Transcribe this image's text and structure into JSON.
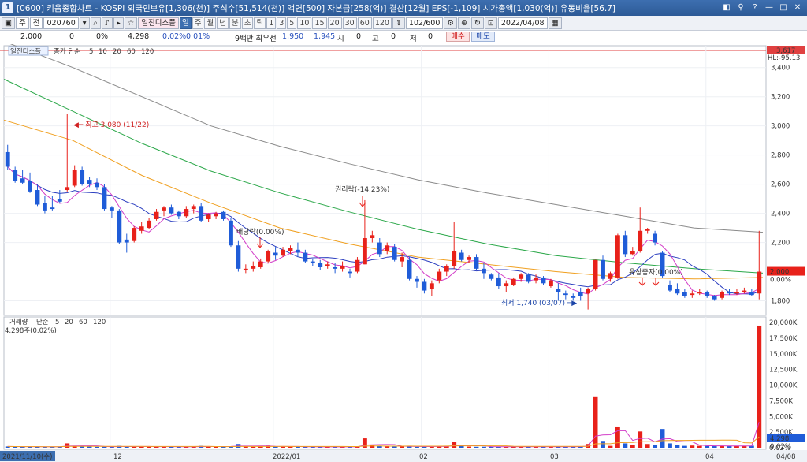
{
  "window": {
    "icon_label": "1",
    "title": "[0600] 키움종합차트 - KOSPI 외국인보유[1,306(천)] 주식수[51,514(천)] 액면[500] 자본금[258(억)] 결산[12월] EPS[-1,109] 시가총액[1,030(억)] 유동비율[56.7]"
  },
  "toolbar": {
    "mode_label": "주",
    "market_label": "전",
    "code_value": "020760",
    "stock_name": "일진디스플",
    "period_buttons": [
      "일",
      "주",
      "월",
      "년",
      "분",
      "초",
      "틱"
    ],
    "selected_period": "일",
    "minute_buttons": [
      "1",
      "3",
      "5",
      "10",
      "15",
      "20",
      "30",
      "60",
      "120"
    ],
    "count_value": "102",
    "count_total": "/600",
    "date_value": "2022/04/08"
  },
  "quote": {
    "price": "2,000",
    "change": "0",
    "change_pct": "0%",
    "volume": "4,298",
    "vol_ratio": "0.02%",
    "turnover": "0.01%",
    "bid_ask_label": "9백만 최우선",
    "ask_price": "1,950",
    "bid_price": "1,945",
    "open_label": "시",
    "open_value": "0",
    "high_label": "고",
    "high_value": "0",
    "low_label": "저",
    "low_value": "0",
    "buy_label": "매수",
    "sell_label": "매도"
  },
  "chart_data": {
    "type": "candlestick",
    "price_legend": {
      "name": "일진디스플",
      "ma_title": "종가 단순",
      "ma_periods": [
        "5",
        "10",
        "20",
        "60",
        "120"
      ],
      "ma_colors": [
        "#d23cc8",
        "#2c3fc0",
        "#f0a020",
        "#2ca84a",
        "#8a8a8a"
      ]
    },
    "volume_legend": {
      "name": "거래량",
      "ma_title": "단순",
      "ma_periods": [
        "5",
        "20",
        "60",
        "120"
      ],
      "value_line": "4,298주(0.02%)"
    },
    "price_axis_ticks": [
      3400,
      3200,
      3000,
      2800,
      2600,
      2400,
      2200,
      1800
    ],
    "price_axis_range": [
      1700,
      3550
    ],
    "volume_axis_ticks": [
      "20,000K",
      "17,500K",
      "15,000K",
      "12,500K",
      "10,000K",
      "7,500K",
      "5,000K",
      "2,500K",
      "0.02%"
    ],
    "volume_axis_range": [
      0,
      20000
    ],
    "date_axis_labels": [
      "2021/11/10(수)",
      "12",
      "2022/01",
      "02",
      "03",
      "04",
      "04/08"
    ],
    "top_marker": {
      "value": "3,617",
      "top_label": "HL:-95.13"
    },
    "current_price_marker": {
      "value": "2,000",
      "pct": "0.00%"
    },
    "volume_marker": {
      "value": "4,298",
      "pct": "0.02%"
    },
    "annotations": [
      {
        "text": "최고 3,080 (11/22)",
        "color": "#d02020"
      },
      {
        "text": "배당락(0.00%)",
        "color": "#333333"
      },
      {
        "text": "권리락(-14.23%)",
        "color": "#333333"
      },
      {
        "text": "유상증자(0.00%)",
        "color": "#333333"
      },
      {
        "text": "최저 1,740 (03/07)",
        "color": "#1c45a8"
      }
    ],
    "candles": [
      [
        2820,
        2870,
        2720,
        2700
      ],
      [
        2700,
        2720,
        2620,
        2610
      ],
      [
        2640,
        2700,
        2610,
        2600
      ],
      [
        2620,
        2680,
        2550,
        2540
      ],
      [
        2560,
        2600,
        2460,
        2450
      ],
      [
        2470,
        2520,
        2420,
        2400
      ],
      [
        2440,
        2520,
        2430,
        2420
      ],
      [
        2500,
        2560,
        2480,
        2470
      ],
      [
        2560,
        3080,
        2580,
        2550
      ],
      [
        2590,
        2730,
        2700,
        2580
      ],
      [
        2700,
        2720,
        2600,
        2590
      ],
      [
        2630,
        2650,
        2600,
        2580
      ],
      [
        2610,
        2640,
        2580,
        2560
      ],
      [
        2580,
        2600,
        2430,
        2420
      ],
      [
        2440,
        2450,
        2420,
        2370
      ],
      [
        2420,
        2430,
        2200,
        2190
      ],
      [
        2220,
        2260,
        2200,
        2130
      ],
      [
        2210,
        2310,
        2300,
        2200
      ],
      [
        2280,
        2340,
        2310,
        2260
      ],
      [
        2300,
        2370,
        2350,
        2290
      ],
      [
        2360,
        2430,
        2410,
        2350
      ],
      [
        2420,
        2450,
        2440,
        2380
      ],
      [
        2440,
        2460,
        2400,
        2390
      ],
      [
        2410,
        2420,
        2380,
        2360
      ],
      [
        2380,
        2450,
        2430,
        2370
      ],
      [
        2430,
        2460,
        2450,
        2400
      ],
      [
        2450,
        2470,
        2350,
        2340
      ],
      [
        2360,
        2400,
        2390,
        2340
      ],
      [
        2380,
        2410,
        2400,
        2360
      ],
      [
        2410,
        2420,
        2360,
        2350
      ],
      [
        2350,
        2370,
        2180,
        2170
      ],
      [
        2180,
        2210,
        2020,
        2000
      ],
      [
        2010,
        2050,
        2020,
        1990
      ],
      [
        2020,
        2070,
        2040,
        2000
      ],
      [
        2030,
        2090,
        2070,
        2020
      ],
      [
        2070,
        2150,
        2140,
        2060
      ],
      [
        2130,
        2170,
        2110,
        2080
      ],
      [
        2110,
        2170,
        2150,
        2100
      ],
      [
        2140,
        2180,
        2160,
        2120
      ],
      [
        2150,
        2200,
        2130,
        2100
      ],
      [
        2130,
        2150,
        2070,
        2060
      ],
      [
        2070,
        2090,
        2060,
        2040
      ],
      [
        2060,
        2080,
        2030,
        2010
      ],
      [
        2040,
        2070,
        2050,
        2020
      ],
      [
        2030,
        2060,
        2020,
        1990
      ],
      [
        2020,
        2070,
        2040,
        2000
      ],
      [
        2000,
        2020,
        1990,
        1960
      ],
      [
        2000,
        2100,
        2080,
        1990
      ],
      [
        2050,
        2490,
        2230,
        2050
      ],
      [
        2230,
        2280,
        2250,
        2200
      ],
      [
        2200,
        2230,
        2120,
        2100
      ],
      [
        2140,
        2200,
        2180,
        2120
      ],
      [
        2170,
        2190,
        2080,
        2070
      ],
      [
        2070,
        2130,
        2100,
        2030
      ],
      [
        2080,
        2100,
        1950,
        1940
      ],
      [
        1950,
        1970,
        1930,
        1890
      ],
      [
        1930,
        1950,
        1870,
        1850
      ],
      [
        1880,
        1940,
        1920,
        1830
      ],
      [
        1940,
        2020,
        2000,
        1920
      ],
      [
        2000,
        2050,
        2040,
        1970
      ],
      [
        2040,
        2340,
        2140,
        2020
      ],
      [
        2130,
        2150,
        2080,
        2070
      ],
      [
        2080,
        2110,
        2100,
        2060
      ],
      [
        2100,
        2120,
        2020,
        2010
      ],
      [
        2020,
        2060,
        1990,
        1950
      ],
      [
        1980,
        1990,
        1950,
        1940
      ],
      [
        1960,
        1990,
        1900,
        1880
      ],
      [
        1900,
        1940,
        1920,
        1860
      ],
      [
        1910,
        1960,
        1950,
        1900
      ],
      [
        1950,
        1990,
        1980,
        1930
      ],
      [
        1980,
        1990,
        1930,
        1920
      ],
      [
        1940,
        1980,
        1960,
        1920
      ],
      [
        1960,
        1970,
        1920,
        1910
      ],
      [
        1900,
        1950,
        1940,
        1890
      ],
      [
        1880,
        1920,
        1860,
        1800
      ],
      [
        1850,
        1870,
        1840,
        1810
      ],
      [
        1830,
        1850,
        1820,
        1800
      ],
      [
        1860,
        1890,
        1830,
        1800
      ],
      [
        1850,
        1890,
        1880,
        1740
      ],
      [
        1880,
        2080,
        2080,
        1870
      ],
      [
        2080,
        2110,
        1950,
        1940
      ],
      [
        1950,
        2000,
        1990,
        1930
      ],
      [
        1960,
        2260,
        2250,
        1950
      ],
      [
        2250,
        2280,
        2120,
        2100
      ],
      [
        2120,
        2170,
        2140,
        2110
      ],
      [
        2140,
        2440,
        2280,
        2130
      ],
      [
        2280,
        2300,
        2290,
        2260
      ],
      [
        2260,
        2280,
        2200,
        2180
      ],
      [
        2130,
        2140,
        1970,
        1960
      ],
      [
        1910,
        1940,
        1870,
        1860
      ],
      [
        1880,
        1920,
        1850,
        1840
      ],
      [
        1860,
        1880,
        1830,
        1820
      ],
      [
        1840,
        1870,
        1850,
        1820
      ],
      [
        1850,
        1880,
        1860,
        1840
      ],
      [
        1860,
        1870,
        1830,
        1820
      ],
      [
        1830,
        1840,
        1810,
        1800
      ],
      [
        1820,
        1870,
        1860,
        1810
      ],
      [
        1860,
        1880,
        1850,
        1840
      ],
      [
        1850,
        1880,
        1860,
        1840
      ],
      [
        1860,
        1890,
        1870,
        1850
      ],
      [
        1860,
        1880,
        1840,
        1830
      ],
      [
        1850,
        2280,
        2000,
        1810
      ]
    ],
    "volumes": [
      200,
      180,
      150,
      170,
      160,
      140,
      150,
      160,
      700,
      300,
      200,
      180,
      150,
      160,
      140,
      300,
      200,
      150,
      180,
      160,
      200,
      170,
      150,
      140,
      160,
      150,
      300,
      180,
      150,
      140,
      250,
      600,
      200,
      150,
      170,
      350,
      200,
      160,
      150,
      140,
      150,
      140,
      130,
      150,
      140,
      130,
      140,
      200,
      1500,
      400,
      250,
      200,
      180,
      200,
      300,
      150,
      140,
      160,
      250,
      300,
      900,
      250,
      180,
      150,
      160,
      140,
      150,
      180,
      170,
      160,
      150,
      160,
      150,
      140,
      200,
      170,
      160,
      180,
      600,
      8200,
      1100,
      300,
      3400,
      700,
      400,
      2600,
      600,
      400,
      3000,
      700,
      400,
      300,
      350,
      300,
      280,
      250,
      300,
      250,
      300,
      280,
      320,
      19500
    ],
    "ma_lines": {
      "ma120": [
        3580,
        3400,
        3200,
        3000,
        2860,
        2740,
        2630,
        2540,
        2460,
        2380,
        2300,
        2270
      ],
      "ma60": [
        3320,
        3100,
        2880,
        2690,
        2540,
        2410,
        2290,
        2190,
        2110,
        2060,
        2020,
        1990
      ],
      "ma20": [
        3040,
        2900,
        2660,
        2470,
        2300,
        2190,
        2100,
        2050,
        2000,
        1960,
        1950,
        1960
      ]
    }
  }
}
